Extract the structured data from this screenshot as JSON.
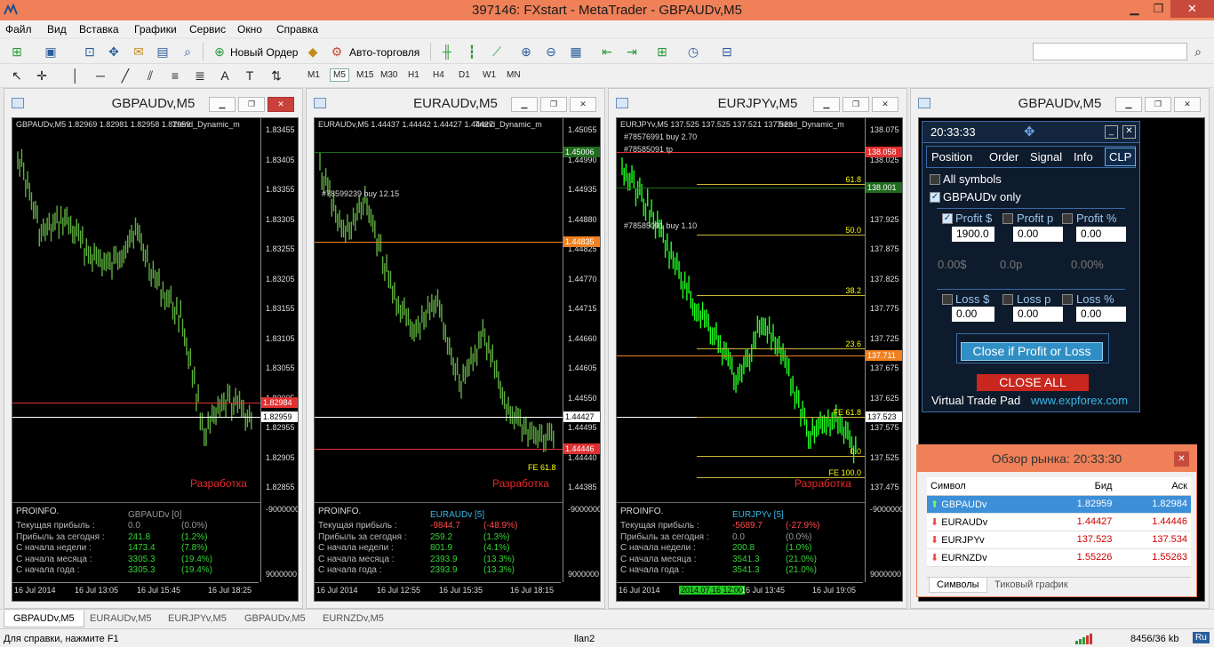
{
  "window": {
    "title": "397146: FXstart - MetaTrader - GBPAUDv,M5"
  },
  "menu": [
    "Файл",
    "Вид",
    "Вставка",
    "Графики",
    "Сервис",
    "Окно",
    "Справка"
  ],
  "toolbar": {
    "new_order": "Новый Ордер",
    "autotrading": "Авто-торговля",
    "timeframes": [
      "M1",
      "M5",
      "M15",
      "M30",
      "H1",
      "H4",
      "D1",
      "W1",
      "MN"
    ],
    "active_tf": "M5"
  },
  "charts": [
    {
      "title": "GBPAUDv,M5",
      "header": "GBPAUDv,M5  1.82969 1.82981 1.82958 1.82959",
      "indicator": "Trend_Dynamic_m",
      "prices": [
        "1.83455",
        "1.83405",
        "1.83355",
        "1.83305",
        "1.83255",
        "1.83205",
        "1.83155",
        "1.83105",
        "1.83055",
        "1.83005",
        "1.82955",
        "1.82905",
        "1.82855"
      ],
      "ask_tag": "1.82984",
      "bid_tag": "1.82959",
      "bottom_ticks": [
        "-9000000",
        "9000000"
      ],
      "time_ticks": [
        "16 Jul 2014",
        "16 Jul 13:05",
        "16 Jul 15:45",
        "16 Jul 18:25"
      ],
      "pro": {
        "head": "PROINFO.",
        "sym": "GBPAUDv [0]",
        "rows": [
          [
            "Текущая прибыль :",
            "0.0",
            "(0.0%)"
          ],
          [
            "Прибыль за сегодня :",
            "241.8",
            "(1.2%)"
          ],
          [
            "С начала недели :",
            "1473.4",
            "(7.8%)"
          ],
          [
            "С начала месяца :",
            "3305.3",
            "(19.4%)"
          ],
          [
            "С начала года :",
            "3305.3",
            "(19.4%)"
          ]
        ]
      },
      "razr": "Разработка"
    },
    {
      "title": "EURAUDv,M5",
      "header": "EURAUDv,M5  1.44437 1.44442 1.44427 1.44427",
      "indicator": "Trend_Dynamic_m",
      "prices": [
        "1.45055",
        "1.44990",
        "1.44935",
        "1.44880",
        "1.44825",
        "1.44770",
        "1.44715",
        "1.44660",
        "1.44605",
        "1.44550",
        "1.44495",
        "1.44440",
        "1.44385"
      ],
      "green_tag": "1.45006",
      "orange_tag": "1.44835",
      "red_tag": "1.44446",
      "bid_tag": "1.44427",
      "order_label": "#78599239 buy 12.15",
      "fe_label": "FE 61.8",
      "bottom_ticks": [
        "-9000000",
        "9000000"
      ],
      "time_ticks": [
        "16 Jul 2014",
        "16 Jul 12:55",
        "16 Jul 15:35",
        "16 Jul 18:15"
      ],
      "pro": {
        "head": "PROINFO.",
        "sym": "EURAUDv [5]",
        "rows": [
          [
            "Текущая прибыль :",
            "-9844.7",
            "(-48.9%)"
          ],
          [
            "Прибыль за сегодня :",
            "259.2",
            "(1.3%)"
          ],
          [
            "С начала недели :",
            "801.9",
            "(4.1%)"
          ],
          [
            "С начала месяца :",
            "2393.9",
            "(13.3%)"
          ],
          [
            "С начала года :",
            "2393.9",
            "(13.3%)"
          ]
        ]
      },
      "razr": "Разработка"
    },
    {
      "title": "EURJPYv,M5",
      "header": "EURJPYv,M5  137.525 137.525 137.521 137.523",
      "indicator": "Trend_Dynamic_m",
      "prices": [
        "138.075",
        "138.025",
        "137.975",
        "137.925",
        "137.875",
        "137.825",
        "137.775",
        "137.725",
        "137.675",
        "137.625",
        "137.575",
        "137.525",
        "137.475"
      ],
      "red_tag": "138.058",
      "green_tag": "138.001",
      "orange_tag": "137.711",
      "bid_tag": "137.523",
      "order1": "#78576991 buy 2.70",
      "order2": "#78585091 tp",
      "order3": "#78585091 buy 1.10",
      "fibs": [
        "61.8",
        "50.0",
        "38.2",
        "23.6",
        "FE 61.8",
        "0.0",
        "FE 100.0"
      ],
      "bottom_ticks": [
        "-9000000",
        "9000000"
      ],
      "time_ticks": [
        "16 Jul 2014",
        "2014.07.16 12:00",
        "16 Jul 13:45",
        "16 Jul 19:05"
      ],
      "pro": {
        "head": "PROINFO.",
        "sym": "EURJPYv [5]",
        "rows": [
          [
            "Текущая прибыль :",
            "-5689.7",
            "(-27.9%)"
          ],
          [
            "Прибыль за сегодня :",
            "0.0",
            "(0.0%)"
          ],
          [
            "С начала недели :",
            "200.8",
            "(1.0%)"
          ],
          [
            "С начала месяца :",
            "3541.3",
            "(21.0%)"
          ],
          [
            "С начала года :",
            "3541.3",
            "(21.0%)"
          ]
        ]
      },
      "razr": "Разработка"
    },
    {
      "title": "GBPAUDv,M5"
    }
  ],
  "pad": {
    "time": "20:33:33",
    "tabs": [
      "Position",
      "Order",
      "Signal",
      "Info",
      "CLP"
    ],
    "active_tab": "CLP",
    "all_symbols": "All symbols",
    "only": "GBPAUDv only",
    "profit_labels": [
      "Profit $",
      "Profit p",
      "Profit %"
    ],
    "profit_values": [
      "1900.0",
      "0.00",
      "0.00"
    ],
    "stats": [
      "0.00$",
      "0.0p",
      "0.00%"
    ],
    "loss_labels": [
      "Loss $",
      "Loss p",
      "Loss %"
    ],
    "loss_values": [
      "0.00",
      "0.00",
      "0.00"
    ],
    "close_btn": "Close if Profit or Loss",
    "close_all": "CLOSE ALL",
    "footer1": "Virtual Trade Pad",
    "footer2": "www.expforex.com"
  },
  "market": {
    "title": "Обзор рынка: 20:33:30",
    "cols": [
      "Символ",
      "Бид",
      "Аск"
    ],
    "rows": [
      [
        "GBPAUDv",
        "1.82959",
        "1.82984"
      ],
      [
        "EURAUDv",
        "1.44427",
        "1.44446"
      ],
      [
        "EURJPYv",
        "137.523",
        "137.534"
      ],
      [
        "EURNZDv",
        "1.55226",
        "1.55263"
      ]
    ],
    "tabs": [
      "Символы",
      "Тиковый график"
    ]
  },
  "doc_tabs": [
    "GBPAUDv,M5",
    "EURAUDv,M5",
    "EURJPYv,M5",
    "GBPAUDv,M5",
    "EURNZDv,M5"
  ],
  "status": {
    "help": "Для справки, нажмите F1",
    "profile": "llan2",
    "traffic": "8456/36 kb",
    "lang": "Ru"
  },
  "colors": {
    "titlebar": "#ef8058",
    "bull": "#34d434",
    "bear": "#ff4b4b",
    "accent": "#3ab7e6"
  }
}
